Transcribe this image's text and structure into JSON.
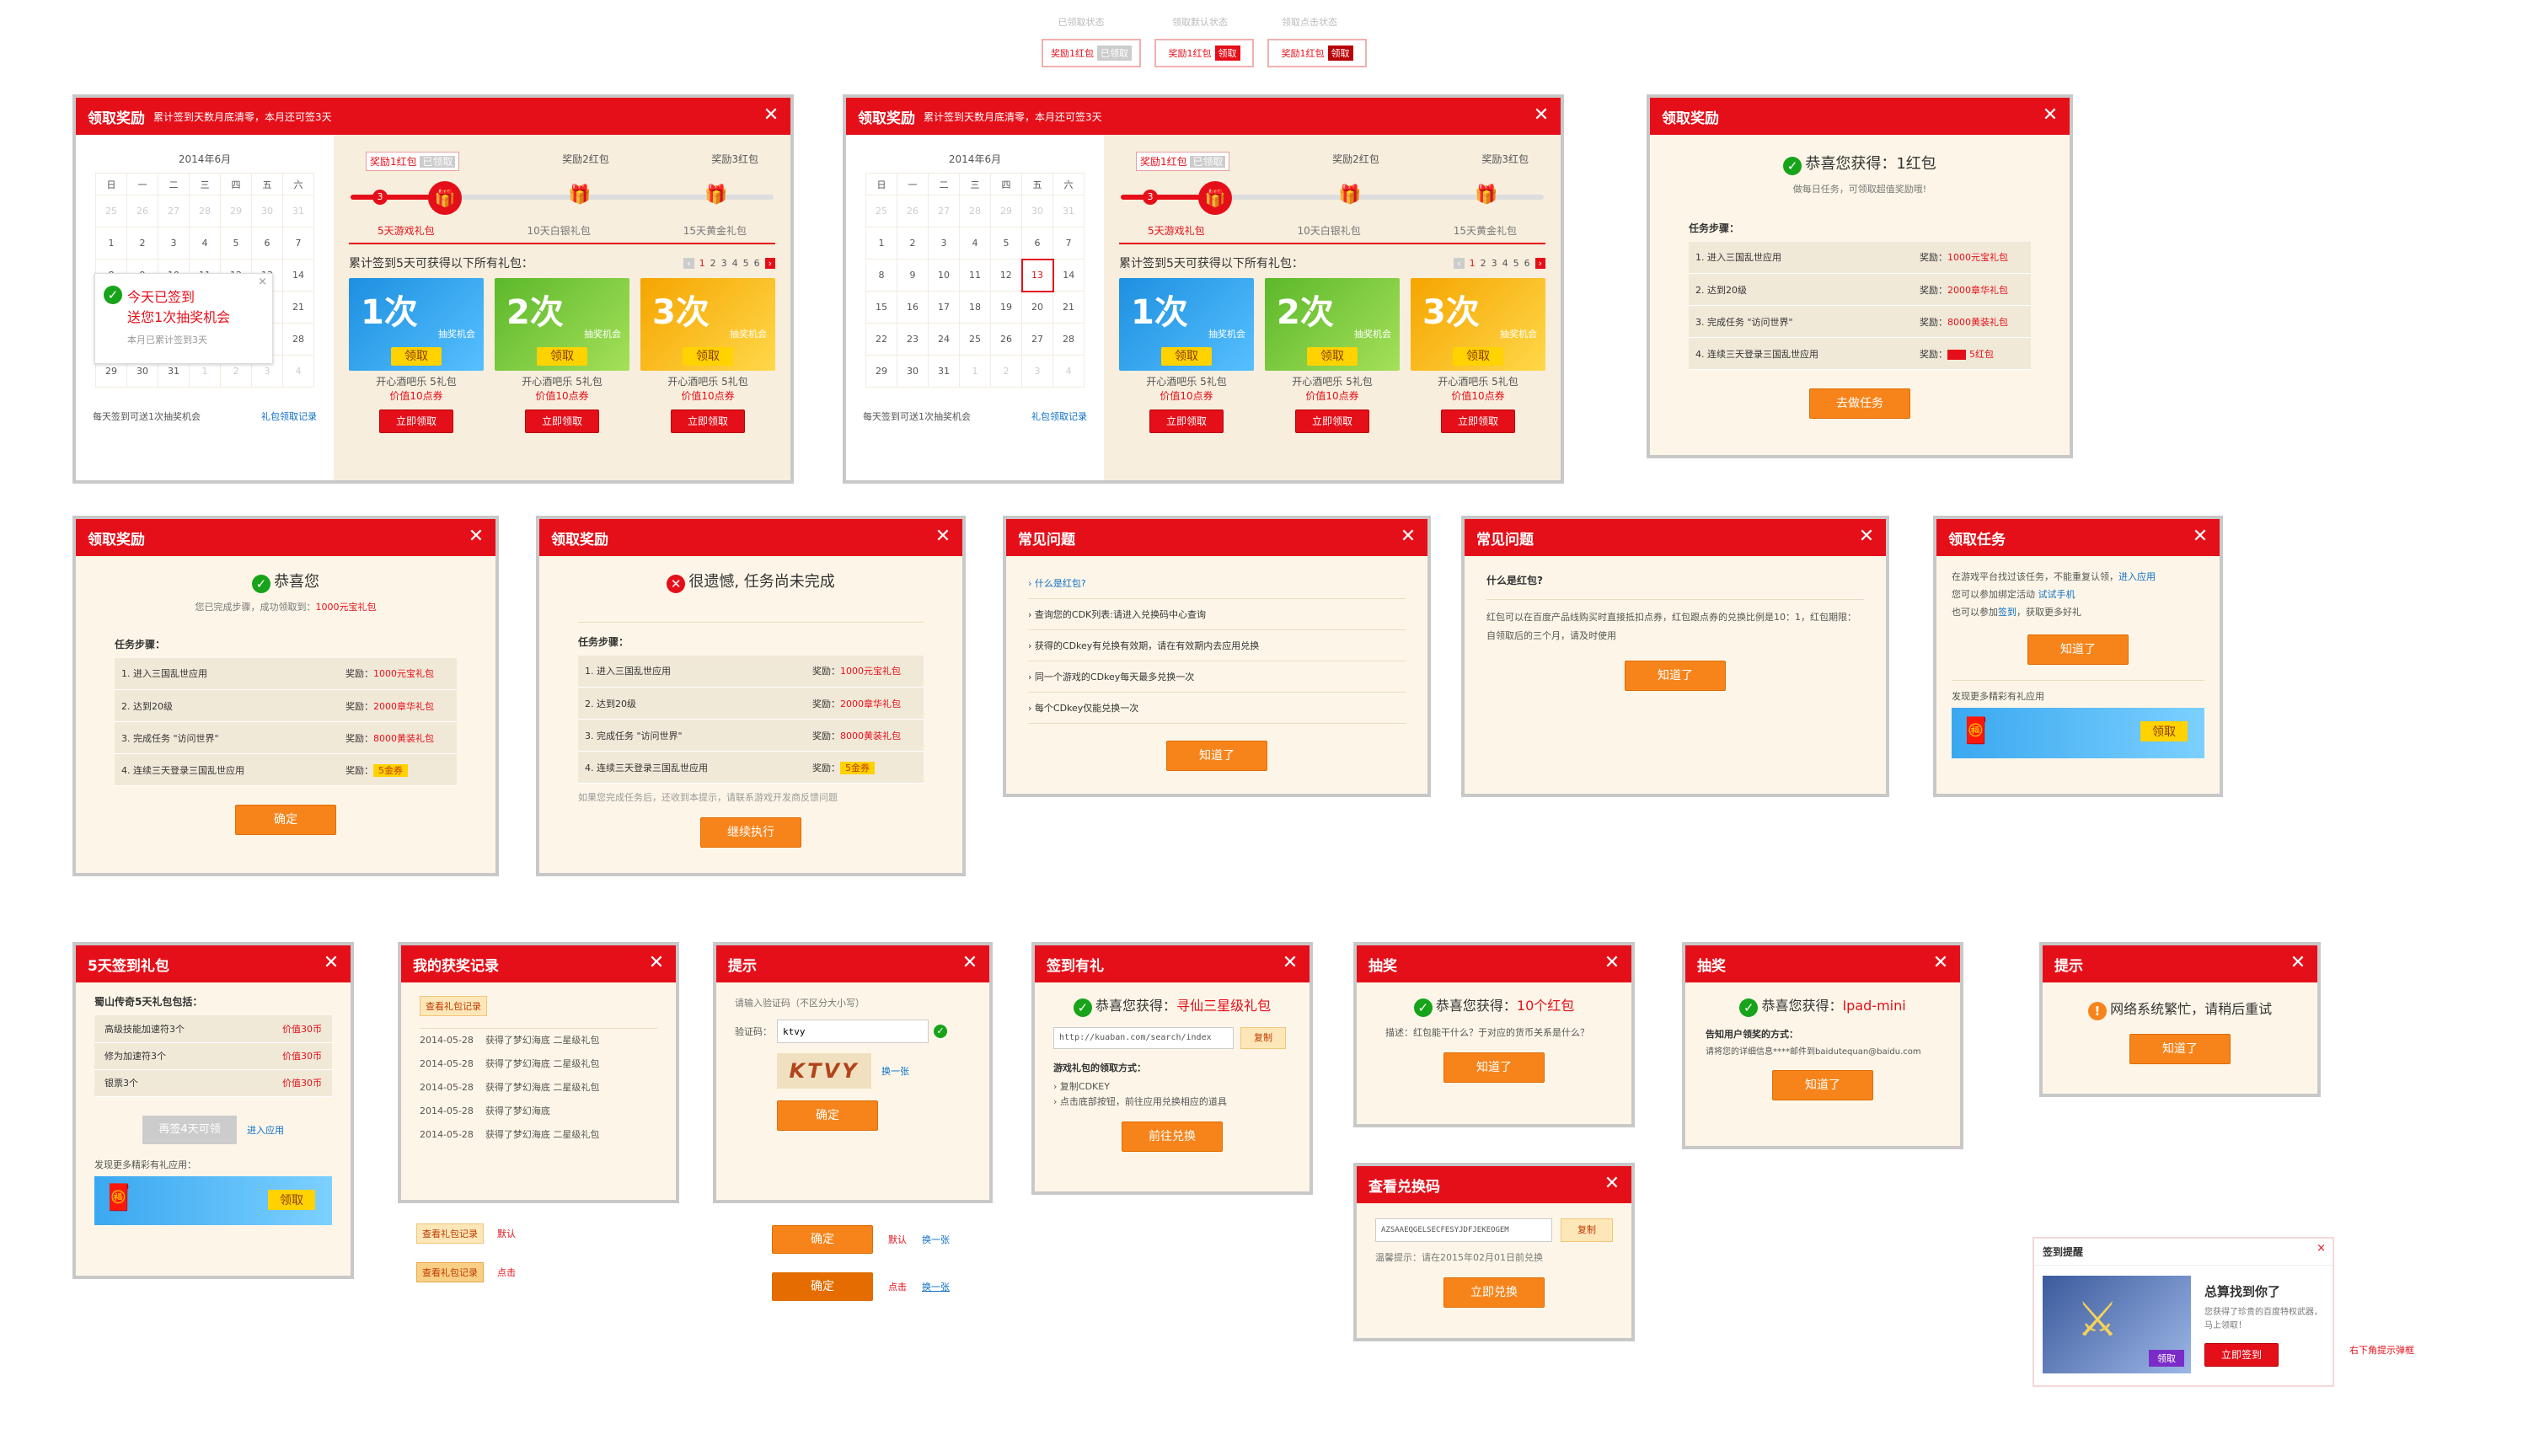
{
  "top_states": [
    {
      "caption": "已领取状态",
      "label": "奖励1红包",
      "btn": "已领取"
    },
    {
      "caption": "领取默认状态",
      "label": "奖励1红包",
      "btn": "领取"
    },
    {
      "caption": "领取点击状态",
      "label": "奖励1红包",
      "btn": "领取"
    }
  ],
  "reward_main": {
    "title": "领取奖励",
    "subtitle": "累计签到天数月底清零，本月还可签3天",
    "month": "2014年6月",
    "weekdays": [
      "日",
      "一",
      "二",
      "三",
      "四",
      "五",
      "六"
    ],
    "tabs": [
      "奖励1红包",
      "奖励2红包",
      "奖励3红包"
    ],
    "tab_claimed": "已领取",
    "step_labels": [
      "5天游戏礼包",
      "10天白银礼包",
      "15天黄金礼包"
    ],
    "step_count": "3",
    "gift_title": "累计签到5天可获得以下所有礼包：",
    "pages": [
      "1",
      "2",
      "3",
      "4",
      "5",
      "6"
    ],
    "gifts": [
      {
        "big": "1次",
        "sub": "抽奖机会",
        "claim": "领取",
        "name": "开心酒吧乐 5礼包",
        "price": "价值10点券",
        "btn": "立即领取"
      },
      {
        "big": "2次",
        "sub": "抽奖机会",
        "claim": "领取",
        "name": "开心酒吧乐 5礼包",
        "price": "价值10点券",
        "btn": "立即领取"
      },
      {
        "big": "3次",
        "sub": "抽奖机会",
        "claim": "领取",
        "name": "开心酒吧乐 5礼包",
        "price": "价值10点券",
        "btn": "立即领取"
      }
    ],
    "footer_left": "每天签到可送1次抽奖机会",
    "footer_right": "礼包领取记录",
    "popup_line1": "今天已签到",
    "popup_line2": "送您1次抽奖机会",
    "popup_line3": "本月已累计签到3天"
  },
  "cal_rows": [
    [
      "25",
      "26",
      "27",
      "28",
      "29",
      "30",
      "31"
    ],
    [
      "1",
      "2",
      "3",
      "4",
      "5",
      "6",
      "7"
    ],
    [
      "8",
      "9",
      "10",
      "11",
      "12",
      "13",
      "14"
    ],
    [
      "15",
      "16",
      "17",
      "18",
      "19",
      "20",
      "21"
    ],
    [
      "22",
      "23",
      "24",
      "25",
      "26",
      "27",
      "28"
    ],
    [
      "29",
      "30",
      "31",
      "1",
      "2",
      "3",
      "4"
    ]
  ],
  "d3": {
    "title": "领取奖励",
    "msg_pre": "恭喜您获得：",
    "msg_val": "1红包",
    "hint": "做每日任务，可领取超值奖励哦!",
    "steps_title": "任务步骤：",
    "tasks": [
      {
        "name": "1. 进入三国乱世应用",
        "reward_label": "奖励：",
        "reward": "1000元宝礼包"
      },
      {
        "name": "2. 达到20级",
        "reward_label": "奖励：",
        "reward": "2000章华礼包"
      },
      {
        "name": "3. 完成任务 \"访问世界\"",
        "reward_label": "奖励：",
        "reward": "8000黄装礼包"
      },
      {
        "name": "4. 连续三天登录三国乱世应用",
        "reward_label": "奖励：",
        "reward": "5红包"
      }
    ],
    "btn": "去做任务"
  },
  "d4": {
    "title": "领取奖励",
    "msg": "恭喜您",
    "sub_pre": "您已完成步骤，成功领取到：",
    "sub_val": "1000元宝礼包",
    "steps_title": "任务步骤：",
    "tasks": [
      {
        "name": "1. 进入三国乱世应用",
        "reward_label": "奖励：",
        "reward": "1000元宝礼包"
      },
      {
        "name": "2. 达到20级",
        "reward_label": "奖励：",
        "reward": "2000章华礼包"
      },
      {
        "name": "3. 完成任务 \"访问世界\"",
        "reward_label": "奖励：",
        "reward": "8000黄装礼包"
      },
      {
        "name": "4. 连续三天登录三国乱世应用",
        "reward_label": "奖励：",
        "reward": "5金券"
      }
    ],
    "btn": "确定"
  },
  "d5": {
    "title": "领取奖励",
    "msg": "很遗憾, 任务尚未完成",
    "steps_title": "任务步骤：",
    "tasks": [
      {
        "name": "1. 进入三国乱世应用",
        "reward_label": "奖励：",
        "reward": "1000元宝礼包"
      },
      {
        "name": "2. 达到20级",
        "reward_label": "奖励：",
        "reward": "2000章华礼包"
      },
      {
        "name": "3. 完成任务 \"访问世界\"",
        "reward_label": "奖励：",
        "reward": "8000黄装礼包"
      },
      {
        "name": "4. 连续三天登录三国乱世应用",
        "reward_label": "奖励：",
        "reward": "5金券"
      }
    ],
    "note": "如果您完成任务后，还收到本提示，请联系游戏开发商反馈问题",
    "btn": "继续执行"
  },
  "d6": {
    "title": "常见问题",
    "items": [
      "什么是红包?",
      "查询您的CDK列表:请进入兑换码中心查询",
      "获得的CDkey有兑换有效期，请在有效期内去应用兑换",
      "同一个游戏的CDkey每天最多兑换一次",
      "每个CDkey仅能兑换一次"
    ],
    "btn": "知道了"
  },
  "d7": {
    "title": "常见问题",
    "q": "什么是红包?",
    "a": "红包可以在百度产品线购买时直接抵扣点券，红包跟点券的兑换比例是10：1，红包期限：自领取后的三个月，请及时使用",
    "btn": "知道了"
  },
  "d8": {
    "title": "领取任务",
    "line1": "在游戏平台找过该任务，不能重复认领，",
    "line1_link": "进入应用",
    "line2": "您可以参加绑定活动",
    "line2_link": "试试手机",
    "line3": "也可以参加",
    "line3_link": "签到",
    "line3_tail": "，获取更多好礼",
    "btn": "知道了",
    "more": "发现更多精彩有礼应用",
    "banner_btn": "领取"
  },
  "d9": {
    "title": "5天签到礼包",
    "sub": "蜀山传奇5天礼包包括：",
    "items": [
      {
        "name": "高级技能加速符3个",
        "price": "价值30币"
      },
      {
        "name": "修为加速符3个",
        "price": "价值30币"
      },
      {
        "name": "银票3个",
        "price": "价值30币"
      }
    ],
    "btn": "再签4天可领",
    "link": "进入应用",
    "more": "发现更多精彩有礼应用：",
    "banner_btn": "领取"
  },
  "d10": {
    "title": "我的获奖记录",
    "tab": "查看礼包记录",
    "rows": [
      {
        "date": "2014-05-28",
        "text": "获得了梦幻海底 二星级礼包"
      },
      {
        "date": "2014-05-28",
        "text": "获得了梦幻海底 二星级礼包"
      },
      {
        "date": "2014-05-28",
        "text": "获得了梦幻海底 二星级礼包"
      },
      {
        "date": "2014-05-28",
        "text": "获得了梦幻海底"
      },
      {
        "date": "2014-05-28",
        "text": "获得了梦幻海底 二星级礼包"
      }
    ],
    "state1_btn": "查看礼包记录",
    "state1_label": "默认",
    "state2_btn": "查看礼包记录",
    "state2_label": "点击"
  },
  "d11": {
    "title": "提示",
    "prompt": "请输入验证码（不区分大小写）",
    "field_label": "验证码：",
    "field_value": "ktvy",
    "captcha": "KTVY",
    "refresh": "换一张",
    "btn": "确定",
    "state1_btn": "确定",
    "state1_label": "默认",
    "state1_link": "换一张",
    "state2_btn": "确定",
    "state2_label": "点击",
    "state2_link": "换一张"
  },
  "d12": {
    "title": "签到有礼",
    "msg_pre": "恭喜您获得：",
    "msg_val": "寻仙三星级礼包",
    "url": "http://kuaban.com/search/index",
    "copy": "复制",
    "method_title": "游戏礼包的领取方式：",
    "m1": "› 复制CDKEY",
    "m2": "› 点击底部按钮，前往应用兑换相应的道具",
    "btn": "前往兑换"
  },
  "d13": {
    "title": "抽奖",
    "msg_pre": "恭喜您获得：",
    "msg_val": "10个红包",
    "desc": "描述：红包能干什么？于对应的货币关系是什么？",
    "btn": "知道了"
  },
  "d14": {
    "title": "抽奖",
    "msg_pre": "恭喜您获得：",
    "msg_val": "Ipad-mini",
    "way": "告知用户领奖的方式：",
    "desc": "请将您的详细信息****邮件到baidutequan@baidu.com",
    "btn": "知道了"
  },
  "d15": {
    "title": "提示",
    "msg": "网络系统繁忙，请稍后重试",
    "btn": "知道了"
  },
  "d16": {
    "title": "查看兑换码",
    "code": "AZSAAEQGELSECFESYJDFJEKEOGEM",
    "copy": "复制",
    "note": "温馨提示：请在2015年02月01日前兑换",
    "btn": "立即兑换"
  },
  "d17": {
    "title": "签到提醒",
    "heading": "总算找到你了",
    "desc": "您获得了珍贵的百度特权武器，马上领取！",
    "img_btn": "领取",
    "btn": "立即签到",
    "side_note": "右下角提示弹框"
  },
  "colors": {
    "red": "#e50f19",
    "orange": "#f7841b",
    "bg": "#fdf6e8",
    "green": "#17a31a"
  }
}
